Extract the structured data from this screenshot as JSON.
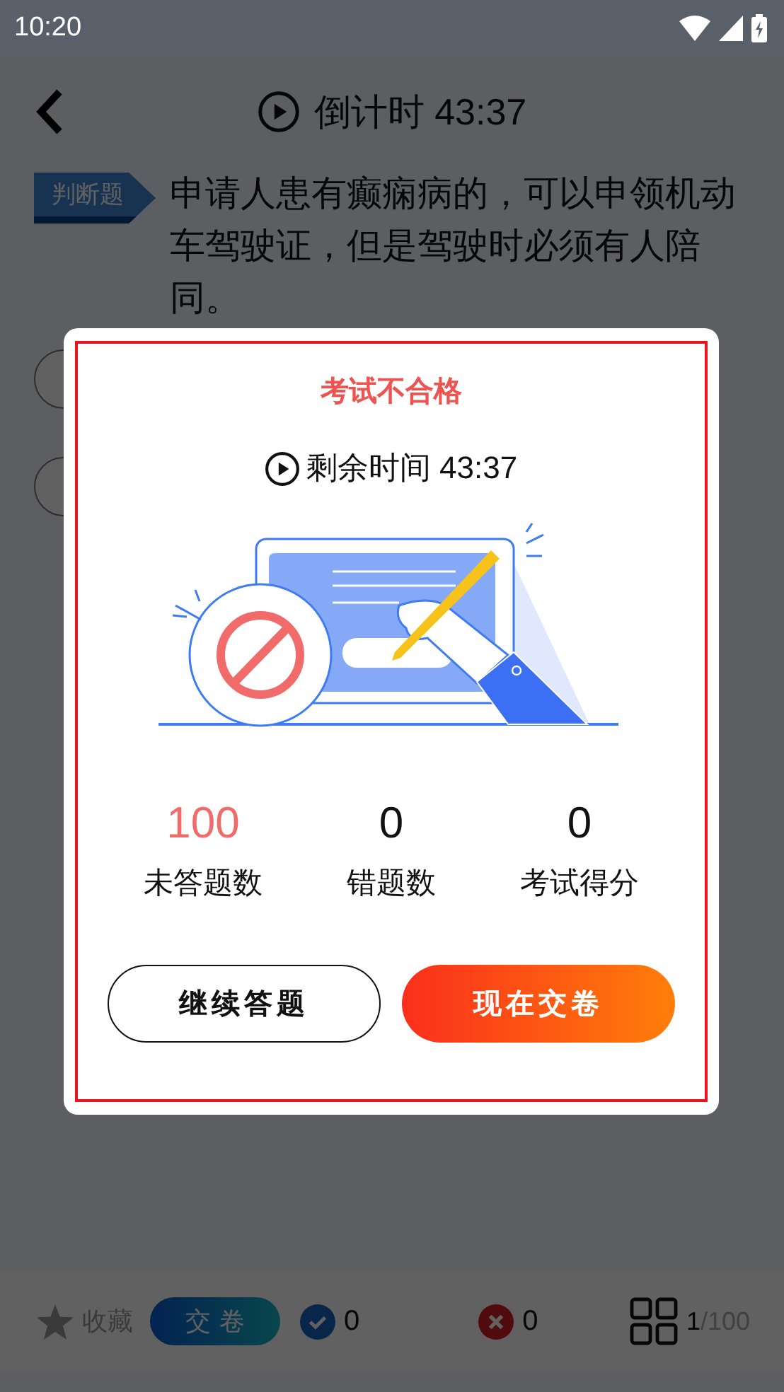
{
  "status_bar": {
    "time": "10:20"
  },
  "header": {
    "title": "倒计时 43:37"
  },
  "question": {
    "tag": "判断题",
    "text": "申请人患有癫痫病的，可以申领机动车驾驶证，但是驾驶时必须有人陪同。"
  },
  "dialog": {
    "title": "考试不合格",
    "remaining": "剩余时间 43:37",
    "stats": [
      {
        "value": "100",
        "label": "未答题数",
        "color": "#f26b6b"
      },
      {
        "value": "0",
        "label": "错题数",
        "color": "#111111"
      },
      {
        "value": "0",
        "label": "考试得分",
        "color": "#111111"
      }
    ],
    "buttons": [
      {
        "label": "继续答题",
        "kind": "outline"
      },
      {
        "label": "现在交卷",
        "kind": "primary"
      }
    ]
  },
  "bottom_bar": {
    "favorite": "收藏",
    "submit": "交卷",
    "correct": "0",
    "wrong": "0",
    "current": "1",
    "total": "/100"
  }
}
